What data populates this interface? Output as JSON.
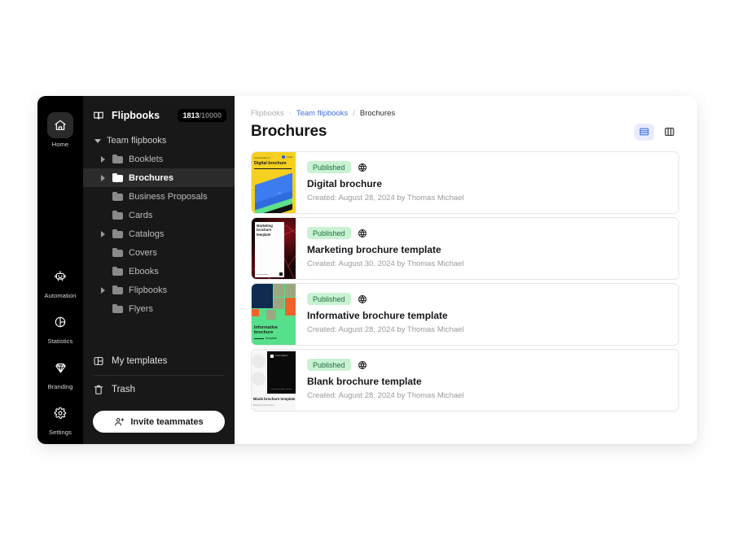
{
  "rail": {
    "items": [
      {
        "label": "Home",
        "icon": "home-icon",
        "active": true
      },
      {
        "label": "Automation",
        "icon": "robot-icon",
        "active": false
      },
      {
        "label": "Statistics",
        "icon": "pie-chart-icon",
        "active": false
      },
      {
        "label": "Branding",
        "icon": "diamond-icon",
        "active": false
      },
      {
        "label": "Settings",
        "icon": "gear-icon",
        "active": false
      }
    ]
  },
  "sidebar": {
    "header": {
      "title": "Flipbooks",
      "icon": "open-book-icon"
    },
    "quota": {
      "used": "1813",
      "total": "/10000"
    },
    "tree": {
      "root_label": "Team flipbooks",
      "folders": [
        {
          "label": "Booklets",
          "expandable": true,
          "selected": false
        },
        {
          "label": "Brochures",
          "expandable": true,
          "selected": true
        },
        {
          "label": "Business Proposals",
          "expandable": false,
          "selected": false
        },
        {
          "label": "Cards",
          "expandable": false,
          "selected": false
        },
        {
          "label": "Catalogs",
          "expandable": true,
          "selected": false
        },
        {
          "label": "Covers",
          "expandable": false,
          "selected": false
        },
        {
          "label": "Ebooks",
          "expandable": false,
          "selected": false
        },
        {
          "label": "Flipbooks",
          "expandable": true,
          "selected": false
        },
        {
          "label": "Flyers",
          "expandable": false,
          "selected": false
        }
      ]
    },
    "my_templates": {
      "label": "My templates",
      "icon": "layout-panels-icon"
    },
    "trash": {
      "label": "Trash",
      "icon": "trash-icon"
    },
    "invite": {
      "label": "Invite teammates",
      "icon": "add-people-icon"
    }
  },
  "main": {
    "breadcrumb": {
      "root": "Flipbooks",
      "dash": "-",
      "link": "Team flipbooks",
      "separator": "/",
      "current": "Brochures"
    },
    "page_title": "Brochures",
    "view_toggles": [
      {
        "name": "list-view",
        "icon": "list-view-icon",
        "active": true
      },
      {
        "name": "grid-view",
        "icon": "grid-view-icon",
        "active": false
      }
    ],
    "cards": [
      {
        "status": "Published",
        "visibility_icon": "globe-icon",
        "title": "Digital brochure",
        "meta": "Created: August 28, 2024 by Thomas Michael",
        "thumb": {
          "style": "t1",
          "kicker": "A presentation of",
          "heading": "Digital brochure",
          "logo": "Lorem"
        }
      },
      {
        "status": "Published",
        "visibility_icon": "globe-icon",
        "title": "Marketing brochure template",
        "meta": "Created: August 30, 2024 by  Thomas Michael",
        "thumb": {
          "style": "t2",
          "heading": "Marketing brochure template"
        }
      },
      {
        "status": "Published",
        "visibility_icon": "globe-icon",
        "title": "Informative brochure template",
        "meta": "Created: August 28, 2024 by  Thomas Michael",
        "thumb": {
          "style": "t3",
          "heading": "Informative brochure",
          "subheading": "template"
        }
      },
      {
        "status": "Published",
        "visibility_icon": "globe-icon",
        "title": "Blank brochure template",
        "meta": "Created: August 28, 2024 by  Thomas Michael",
        "thumb": {
          "style": "t4",
          "heading": "Blank brochure template",
          "subheading": "Build your own brochure"
        }
      }
    ]
  },
  "colors": {
    "accent_blue": "#3f6fe0",
    "badge_bg": "#c9f2d4",
    "badge_text": "#1d6b38",
    "rail_bg": "#000000",
    "sidebar_bg": "#181818",
    "selected_row": "#2b2b2b"
  }
}
